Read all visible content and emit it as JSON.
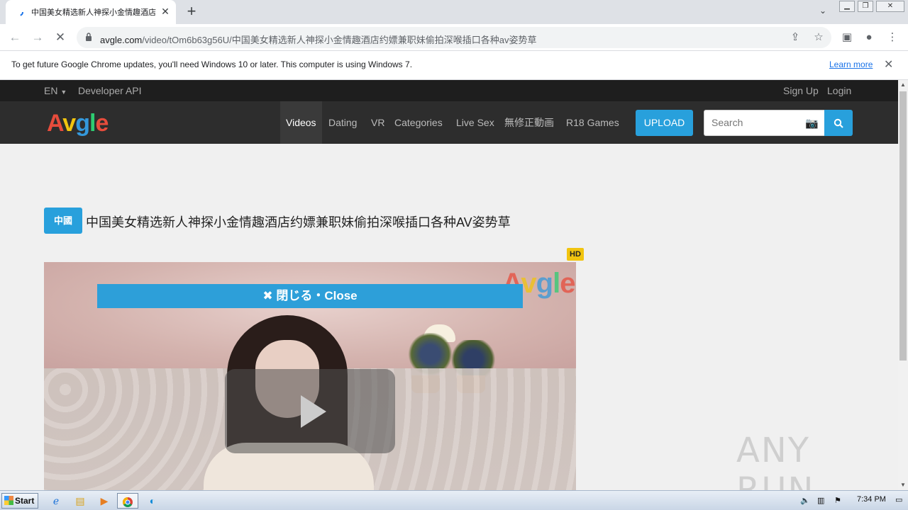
{
  "browser": {
    "tab_title": "中国美女精选新人神探小金情趣酒店约嫖兼职妹偷拍深喉插口各种AV姿势草",
    "tab_close": "✕",
    "new_tab": "+",
    "url_host": "avgle.com",
    "url_path": "/video/tOm6b63g56U/中国美女精选新人神探小金情趣酒店约嫖兼职妹偷拍深喉插口各种av姿势草",
    "infobar_message": "To get future Google Chrome updates, you'll need Windows 10 or later. This computer is using Windows 7.",
    "infobar_link": "Learn more"
  },
  "site": {
    "lang": "EN",
    "developer_api": "Developer API",
    "sign_up": "Sign Up",
    "login": "Login",
    "logo": {
      "a": "A",
      "v": "v",
      "g": "g",
      "l": "l",
      "e": "e"
    },
    "nav": [
      "Videos",
      "Dating",
      "VR",
      "Categories",
      "Live Sex",
      "無修正動画",
      "R18 Games"
    ],
    "upload": "UPLOAD",
    "search_placeholder": "Search"
  },
  "video": {
    "category_badge": "中國",
    "title": "中国美女精选新人神探小金情趣酒店约嫖兼职妹偷拍深喉插口各种AV姿势草",
    "hd_badge": "HD",
    "close_bar": "✖ 閉じる・Close"
  },
  "watermark": "ANY RUN",
  "taskbar": {
    "start": "Start",
    "clock": "7:34 PM"
  },
  "colors": {
    "accent": "#28a0dc",
    "logo_red": "#e74c3c",
    "logo_blue": "#3498db",
    "logo_yellow": "#f1c40f",
    "logo_green": "#2ecc71"
  }
}
